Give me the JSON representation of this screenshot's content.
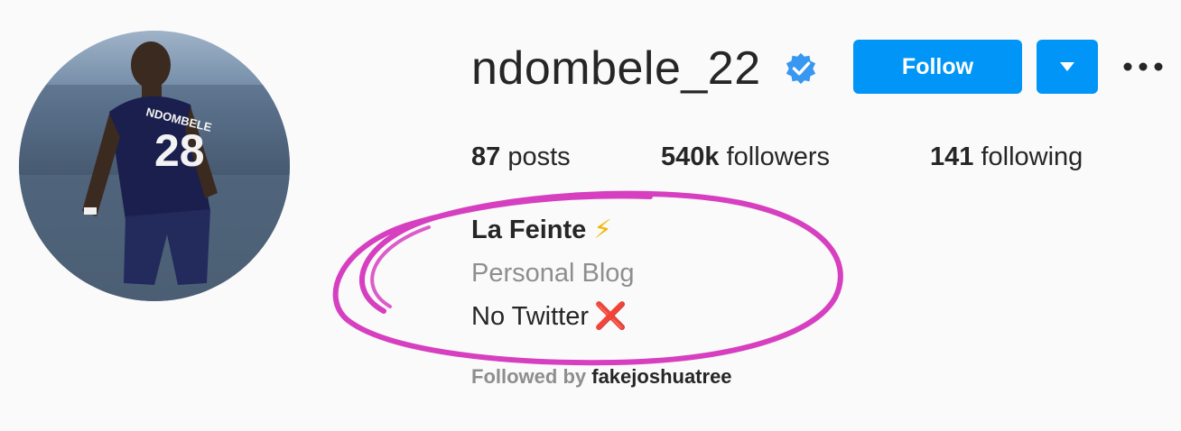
{
  "profile": {
    "username": "ndombele_22",
    "verified_icon": "verified-badge-icon",
    "avatar_jersey_name": "NDOMBELE",
    "avatar_jersey_number": "28"
  },
  "actions": {
    "follow_label": "Follow",
    "dropdown_icon": "chevron-down-icon",
    "options_icon": "more-options-icon"
  },
  "stats": {
    "posts_count": "87",
    "posts_label": "posts",
    "followers_count": "540k",
    "followers_label": "followers",
    "following_count": "141",
    "following_label": "following"
  },
  "bio": {
    "name": "La Feinte",
    "name_emoji": "⚡",
    "category": "Personal Blog",
    "text": "No Twitter",
    "text_emoji": "❌",
    "followed_by_prefix": "Followed by",
    "followed_by_user": "fakejoshuatree"
  },
  "colors": {
    "accent": "#0095f6",
    "verified": "#3897f0",
    "highlight": "#d63fbf",
    "muted": "#8e8e8e"
  }
}
